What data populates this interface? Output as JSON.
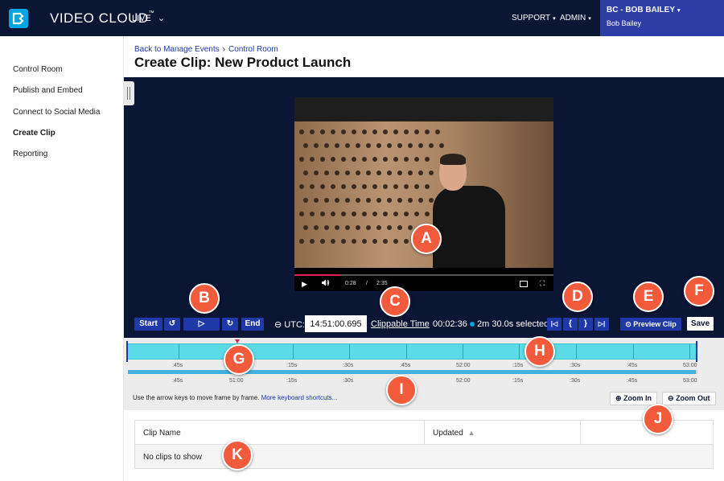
{
  "topbar": {
    "brand": "VIDEO CLOUD",
    "brand_tm": "™",
    "live_menu": "LIVE",
    "support_menu": "SUPPORT",
    "admin_menu": "ADMIN",
    "account": "BC - BOB BAILEY",
    "user_name": "Bob Bailey",
    "caret": "▾",
    "chevron": "⌄"
  },
  "sidebar": {
    "items": [
      {
        "label": "Control Room"
      },
      {
        "label": "Publish and Embed"
      },
      {
        "label": "Connect to Social Media"
      },
      {
        "label": "Create Clip"
      },
      {
        "label": "Reporting"
      }
    ]
  },
  "breadcrumb": {
    "back": "Back to Manage Events",
    "separator": "›",
    "current": "Control Room"
  },
  "page_title": "Create Clip: New Product Launch",
  "player": {
    "current_time": "0:28",
    "separator": "/",
    "duration": "2:35",
    "play_glyph": "▶",
    "volume_glyph": "🔊",
    "fullscreen_glyph": "⛶",
    "progress_fraction": 0.18
  },
  "controls": {
    "start": "Start",
    "rewind_glyph": "↺",
    "play_glyph": "▷",
    "forward_glyph": "↻",
    "end": "End",
    "utc_label": "UTC:",
    "utc_icon": "⊖",
    "utc_value": "14:51:00.695",
    "clippable": "Clippable Time",
    "elapsed": "00:02:36",
    "selected": "2m 30.0s selected",
    "first_frame_glyph": "|◁",
    "in_glyph": "{",
    "out_glyph": "}",
    "last_frame_glyph": "▷|",
    "preview_clip": "Preview Clip",
    "preview_icon": "⊙",
    "save": "Save"
  },
  "timeline": {
    "top_ticks": [
      ":45s",
      ":15s",
      ":30s",
      ":45s",
      "52:00",
      ":15s",
      ":30s",
      ":45s",
      "53:00"
    ],
    "bottom_ticks": [
      ":45s",
      "51:00",
      ":15s",
      ":30s",
      ":45s",
      "52:00",
      ":15s",
      ":30s",
      ":45s",
      "53:00"
    ]
  },
  "hint": {
    "text": "Use the arrow keys to move frame by frame.",
    "link": "More keyboard shortcuts..."
  },
  "zoom": {
    "zoom_in": "Zoom In",
    "zoom_out": "Zoom Out",
    "zoom_in_icon": "⊕",
    "zoom_out_icon": "⊖"
  },
  "table": {
    "columns": [
      {
        "label": "Clip Name"
      },
      {
        "label": "Updated",
        "sort_glyph": "▲"
      },
      {
        "label": ""
      }
    ],
    "empty_text": "No clips to show"
  },
  "callouts": [
    "A",
    "B",
    "C",
    "D",
    "E",
    "F",
    "G",
    "H",
    "I",
    "J",
    "K"
  ],
  "colors": {
    "navy": "#0b1534",
    "brand_blue": "#1f3aa8",
    "timeline_cyan": "#5bdbe6",
    "callout": "#f15a3a"
  }
}
